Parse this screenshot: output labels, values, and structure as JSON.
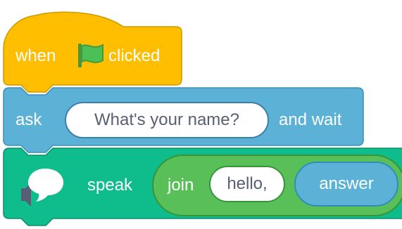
{
  "blocks": {
    "hat": {
      "word_when": "when",
      "word_clicked": "clicked",
      "flag_icon": "green-flag-icon",
      "color": "#ffbf00"
    },
    "ask": {
      "word_ask": "ask",
      "question_value": "What's your name?",
      "word_and_wait": "and wait",
      "color": "#5cb1d6"
    },
    "speak": {
      "speaker_icon": "speech-bubble-icon",
      "word_speak": "speak",
      "word_join": "join",
      "join_first": "hello,",
      "join_second": "answer",
      "color": "#0fbd8c"
    }
  }
}
